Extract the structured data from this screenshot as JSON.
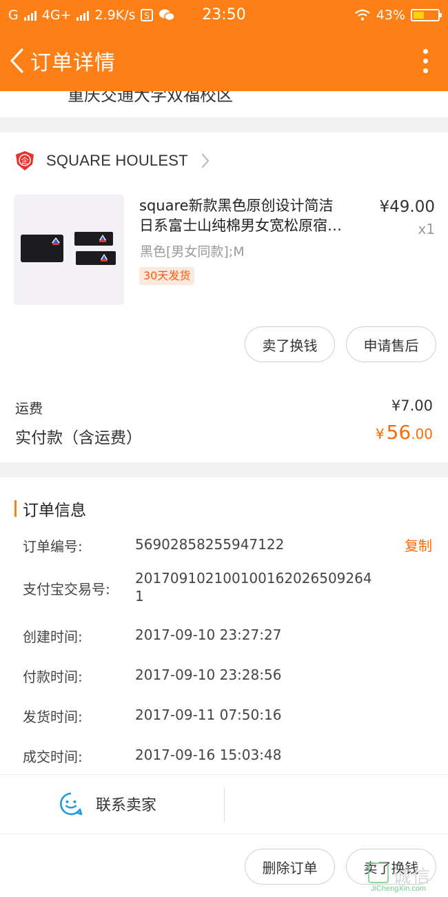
{
  "status_bar": {
    "carrier": "G",
    "network": "4G+",
    "speed": "2.9K/s",
    "time": "23:50",
    "battery": "43%",
    "battery_level": 0.43
  },
  "header": {
    "title": "订单详情",
    "back_icon": "chevron-left-icon",
    "more_icon": "more-vertical-icon"
  },
  "address": {
    "partial_text": "重庆交通大学双福校区"
  },
  "shop": {
    "name": "SQUARE HOULEST",
    "logo_text": "企"
  },
  "product": {
    "title_line1": "square新款黑色原创设计简洁",
    "title_line2": "日系富士山纯棉男女宽松原宿…",
    "price": "¥49.00",
    "quantity": "x1",
    "spec": "黑色[男女同款];M",
    "tag": "30天发货"
  },
  "product_actions": {
    "sell": "卖了换钱",
    "after_sales": "申请售后"
  },
  "summary": {
    "shipping_label": "运费",
    "shipping_value": "¥7.00",
    "paid_label": "实付款（含运费）",
    "paid_currency": "¥",
    "paid_integer": "56",
    "paid_decimal": ".00"
  },
  "order_info": {
    "heading": "订单信息",
    "copy": "复制",
    "rows": [
      {
        "label": "订单编号:",
        "value": "56902858255947122"
      },
      {
        "label": "支付宝交易号:",
        "value": "2017091021001001620265092641"
      },
      {
        "label": "创建时间:",
        "value": "2017-09-10 23:27:27"
      },
      {
        "label": "付款时间:",
        "value": "2017-09-10 23:28:56"
      },
      {
        "label": "发货时间:",
        "value": "2017-09-11 07:50:16"
      },
      {
        "label": "成交时间:",
        "value": "2017-09-16 15:03:48"
      }
    ]
  },
  "contact": {
    "label": "联系卖家",
    "icon": "chat-bubble-icon"
  },
  "bottom_actions": {
    "delete": "删除订单",
    "sell": "卖了换钱"
  },
  "watermark": {
    "cn": "诚信",
    "en": "JiChengXin.com"
  },
  "colors": {
    "brand": "#ff7f17",
    "price_accent": "#ff6a00"
  }
}
